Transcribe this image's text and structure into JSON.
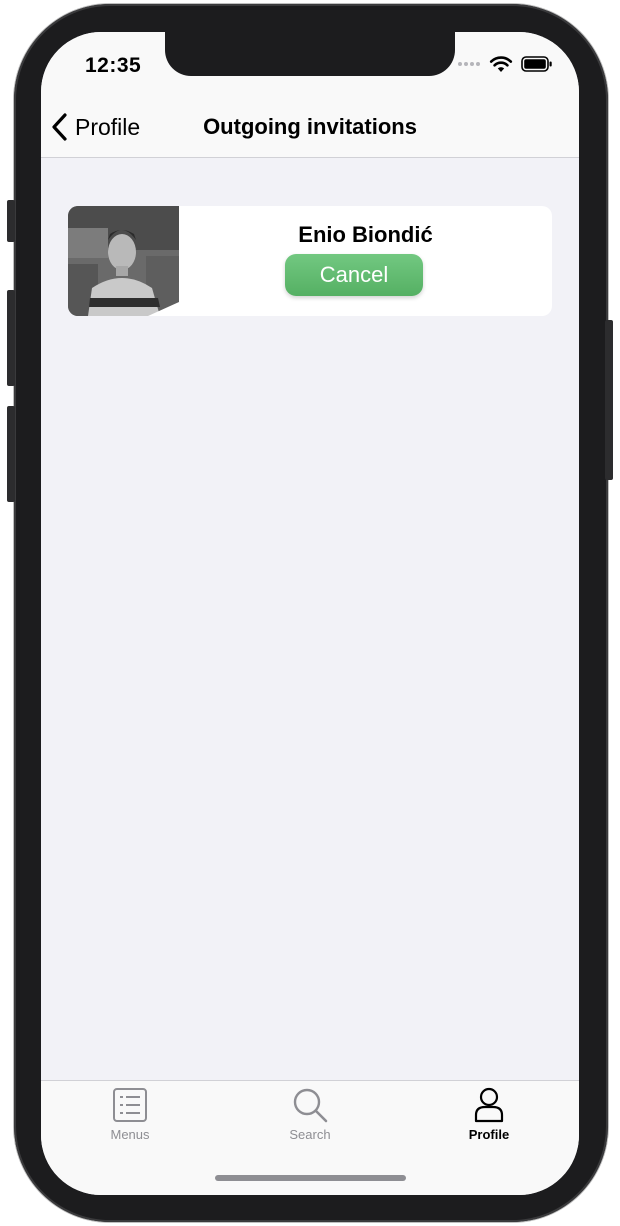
{
  "status_bar": {
    "time": "12:35"
  },
  "nav": {
    "back_label": "Profile",
    "title": "Outgoing invitations"
  },
  "invitations": [
    {
      "name": "Enio Biondić",
      "action_label": "Cancel"
    }
  ],
  "tabs": [
    {
      "label": "Menus",
      "icon": "list-icon",
      "active": false
    },
    {
      "label": "Search",
      "icon": "magnifier-icon",
      "active": false
    },
    {
      "label": "Profile",
      "icon": "person-icon",
      "active": true
    }
  ],
  "colors": {
    "accent_green": "#5cb86a",
    "background": "#f2f2f7",
    "bar_background": "#f9f9f9",
    "inactive_tab": "#8e8e93"
  }
}
